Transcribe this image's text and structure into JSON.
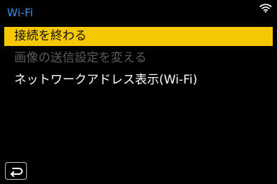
{
  "header": {
    "title": "Wi-Fi",
    "status_icon": "wifi-icon"
  },
  "menu": {
    "items": [
      {
        "label": "接続を終わる",
        "state": "selected"
      },
      {
        "label": "画像の送信設定を変える",
        "state": "disabled"
      },
      {
        "label": "ネットワークアドレス表示(Wi-Fi)",
        "state": "normal"
      }
    ]
  },
  "footer": {
    "back_icon": "return-arrow-icon"
  },
  "colors": {
    "background": "#000000",
    "title": "#3a8fe6",
    "selection": "#f6c800",
    "disabled_text": "#5a5a5a",
    "text": "#ffffff"
  }
}
